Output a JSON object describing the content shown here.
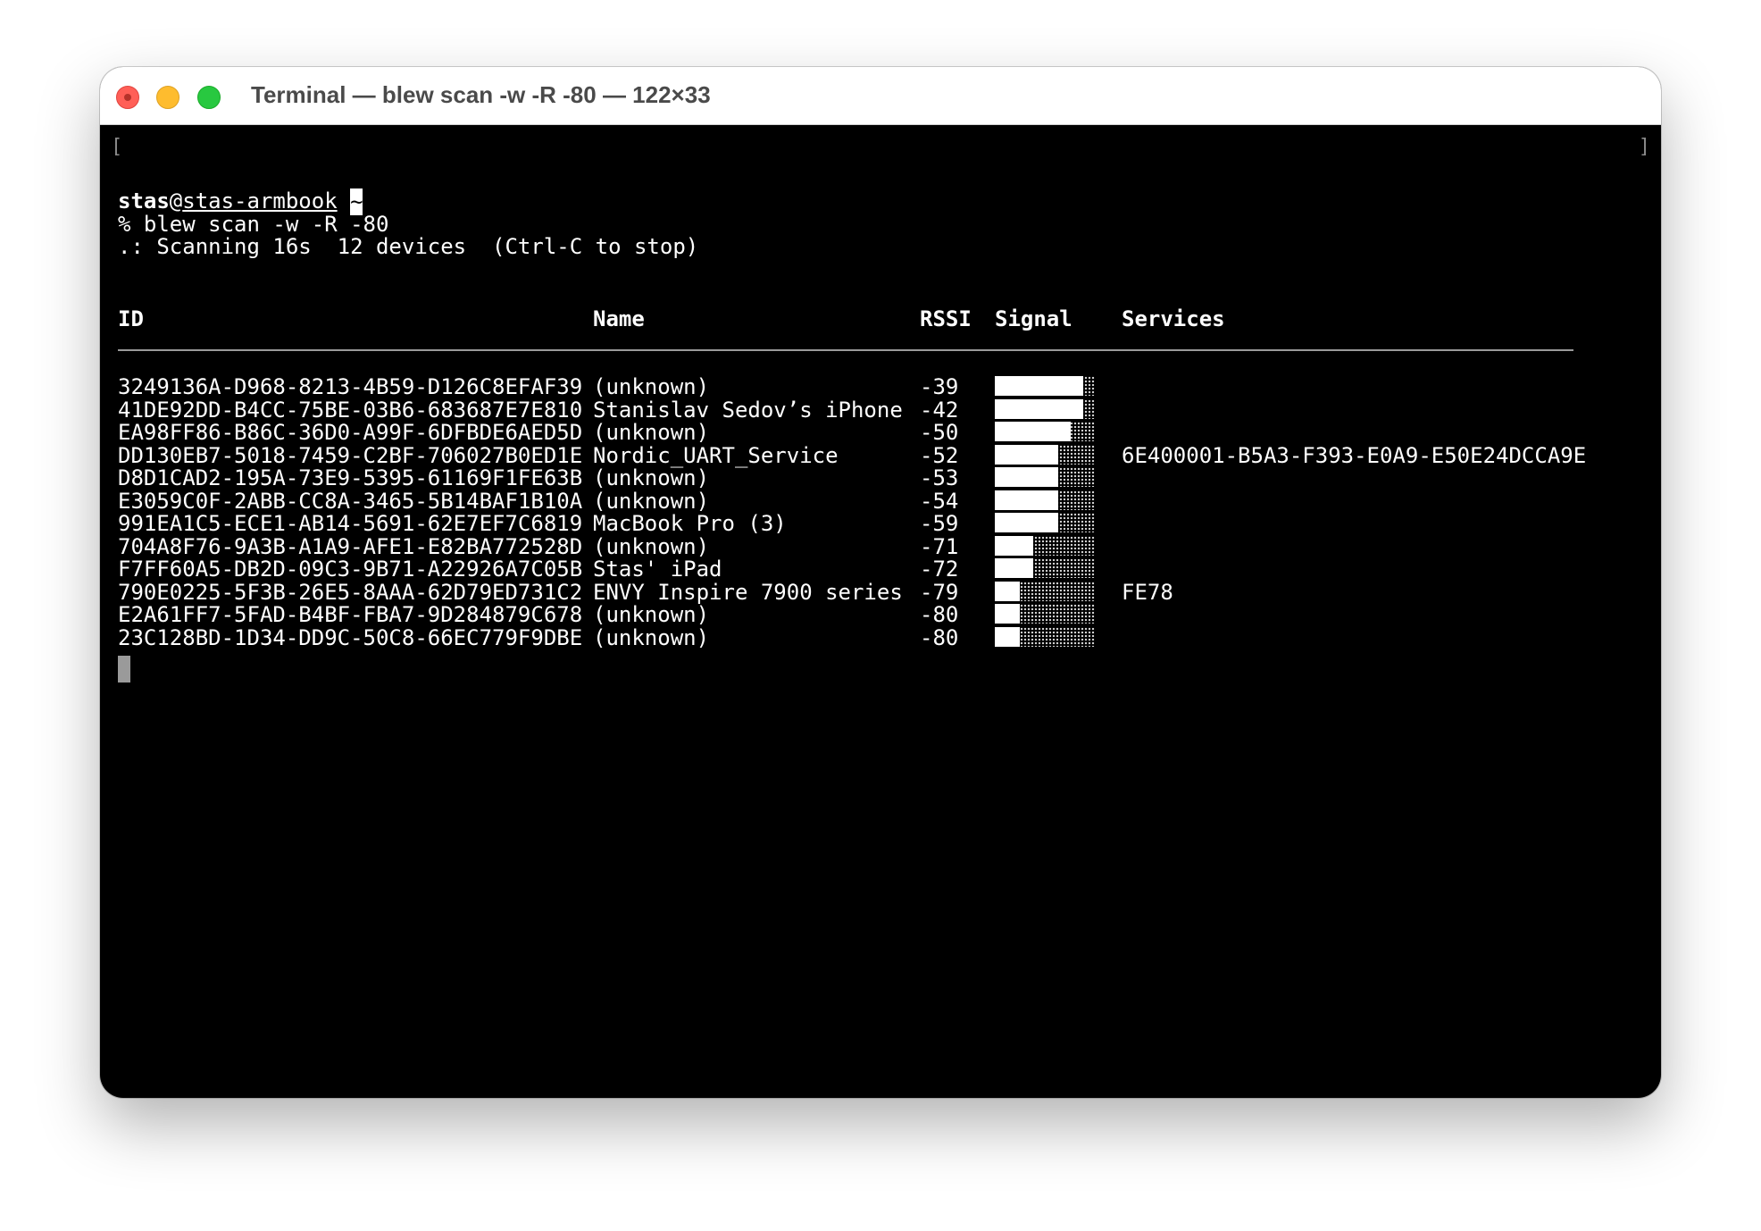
{
  "window": {
    "title": "Terminal — blew scan -w -R -80 — 122×33"
  },
  "terminal": {
    "left_bracket": "[",
    "right_bracket": "]",
    "prompt": {
      "user": "stas",
      "at": "@",
      "host": "stas-armbook",
      "dir": "~"
    },
    "command": "% blew scan -w -R -80",
    "status": ".: Scanning 16s  12 devices  (Ctrl-C to stop)",
    "table": {
      "headers": {
        "id": "ID",
        "name": "Name",
        "rssi": "RSSI",
        "signal": "Signal",
        "services": "Services"
      },
      "rows": [
        {
          "id": "3249136A-D968-8213-4B59-D126C8EFAF39",
          "name": "(unknown)",
          "rssi": "-39",
          "signal": 0.88,
          "services": ""
        },
        {
          "id": "41DE92DD-B4CC-75BE-03B6-683687E7E810",
          "name": "Stanislav Sedov’s iPhone",
          "rssi": "-42",
          "signal": 0.88,
          "services": ""
        },
        {
          "id": "EA98FF86-B86C-36D0-A99F-6DFBDE6AED5D",
          "name": "(unknown)",
          "rssi": "-50",
          "signal": 0.76,
          "services": ""
        },
        {
          "id": "DD130EB7-5018-7459-C2BF-706027B0ED1E",
          "name": "Nordic_UART_Service",
          "rssi": "-52",
          "signal": 0.63,
          "services": "6E400001-B5A3-F393-E0A9-E50E24DCCA9E"
        },
        {
          "id": "D8D1CAD2-195A-73E9-5395-61169F1FE63B",
          "name": "(unknown)",
          "rssi": "-53",
          "signal": 0.63,
          "services": ""
        },
        {
          "id": "E3059C0F-2ABB-CC8A-3465-5B14BAF1B10A",
          "name": "(unknown)",
          "rssi": "-54",
          "signal": 0.63,
          "services": ""
        },
        {
          "id": "991EA1C5-ECE1-AB14-5691-62E7EF7C6819",
          "name": "MacBook Pro (3)",
          "rssi": "-59",
          "signal": 0.63,
          "services": ""
        },
        {
          "id": "704A8F76-9A3B-A1A9-AFE1-E82BA772528D",
          "name": "(unknown)",
          "rssi": "-71",
          "signal": 0.38,
          "services": ""
        },
        {
          "id": "F7FF60A5-DB2D-09C3-9B71-A22926A7C05B",
          "name": "Stas' iPad",
          "rssi": "-72",
          "signal": 0.38,
          "services": ""
        },
        {
          "id": "790E0225-5F3B-26E5-8AAA-62D79ED731C2",
          "name": "ENVY Inspire 7900 series",
          "rssi": "-79",
          "signal": 0.25,
          "services": "FE78"
        },
        {
          "id": "E2A61FF7-5FAD-B4BF-FBA7-9D284879C678",
          "name": "(unknown)",
          "rssi": "-80",
          "signal": 0.25,
          "services": ""
        },
        {
          "id": "23C128BD-1D34-DD9C-50C8-66EC779F9DBE",
          "name": "(unknown)",
          "rssi": "-80",
          "signal": 0.25,
          "services": ""
        }
      ]
    }
  }
}
